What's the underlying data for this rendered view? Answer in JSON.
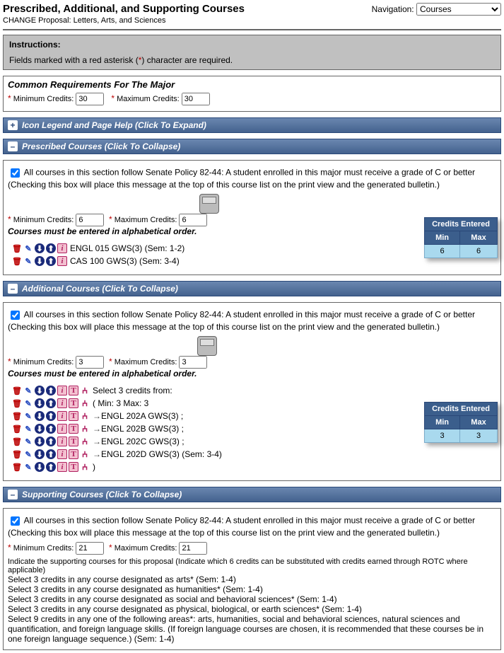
{
  "header": {
    "title": "Prescribed, Additional, and Supporting Courses",
    "subtitle": "CHANGE Proposal: Letters, Arts, and Sciences",
    "nav_label": "Navigation:",
    "nav_selected": "Courses"
  },
  "instructions": {
    "heading": "Instructions:",
    "text_before": "Fields marked with a red asterisk (",
    "asterisk": "*",
    "text_after": ") character are required."
  },
  "common": {
    "title": "Common Requirements For The Major",
    "min_label": " Minimum Credits: ",
    "min_value": "30",
    "max_label": " Maximum Credits: ",
    "max_value": "30"
  },
  "legend_bar": {
    "toggle": "+",
    "label": "Icon Legend and Page Help (Click To Expand)"
  },
  "prescribed": {
    "bar_toggle": "–",
    "bar_label": "Prescribed Courses (Click To Collapse)",
    "policy_checked": true,
    "policy_text": "All courses in this section follow Senate Policy 82-44: A student enrolled in this major must receive a grade of C or better",
    "policy_sub": "(Checking this box will place this message at the top of this course list on the print view and the generated bulletin.)",
    "min_label": " Minimum Credits: ",
    "min_value": "6",
    "max_label": " Maximum Credits: ",
    "max_value": "6",
    "alpha_note": "Courses must be entered in alphabetical order.",
    "credits": {
      "header": "Credits Entered",
      "min_h": "Min",
      "max_h": "Max",
      "min_v": "6",
      "max_v": "6"
    },
    "rows": [
      {
        "text": "ENGL 015 GWS(3) (Sem: 1-2)"
      },
      {
        "text": "CAS 100 GWS(3) (Sem: 3-4)"
      }
    ]
  },
  "additional": {
    "bar_toggle": "–",
    "bar_label": "Additional Courses (Click To Collapse)",
    "policy_checked": true,
    "policy_text": "All courses in this section follow Senate Policy 82-44: A student enrolled in this major must receive a grade of C or better",
    "policy_sub": "(Checking this box will place this message at the top of this course list on the print view and the generated bulletin.)",
    "min_label": " Minimum Credits: ",
    "min_value": "3",
    "max_label": " Maximum Credits: ",
    "max_value": "3",
    "alpha_note": "Courses must be entered in alphabetical order.",
    "credits": {
      "header": "Credits Entered",
      "min_h": "Min",
      "max_h": "Max",
      "min_v": "3",
      "max_v": "3"
    },
    "rows": [
      {
        "text": "Select 3 credits from:",
        "arrow": false
      },
      {
        "text": "( Min: 3 Max: 3",
        "arrow": false
      },
      {
        "text": "ENGL 202A GWS(3) ;",
        "arrow": true
      },
      {
        "text": "ENGL 202B GWS(3) ;",
        "arrow": true
      },
      {
        "text": "ENGL 202C GWS(3) ;",
        "arrow": true
      },
      {
        "text": "ENGL 202D GWS(3) (Sem: 3-4)",
        "arrow": true
      },
      {
        "text": ")",
        "arrow": false
      }
    ]
  },
  "supporting": {
    "bar_toggle": "–",
    "bar_label": "Supporting Courses (Click To Collapse)",
    "policy_checked": true,
    "policy_text": "All courses in this section follow Senate Policy 82-44: A student enrolled in this major must receive a grade of C or better",
    "policy_sub": "(Checking this box will place this message at the top of this course list on the print view and the generated bulletin.)",
    "min_label": " Minimum Credits: ",
    "min_value": "21",
    "max_label": " Maximum Credits: ",
    "max_value": "21",
    "desc_bold": "Indicate the supporting courses for this proposal ",
    "desc_rest": "(Indicate which 6 credits can be substituted with credits earned through ROTC where applicable)",
    "lines": [
      "Select 3 credits in any course designated as arts* (Sem: 1-4)",
      "Select 3 credits in any course designated as humanities* (Sem: 1-4)",
      "Select 3 credits in any course designated as social and behavioral sciences* (Sem: 1-4)",
      "Select 3 credits in any course designated as physical, biological, or earth sciences* (Sem: 1-4)",
      "Select 9 credits in any one of the following areas*: arts, humanities, social and behavioral sciences, natural sciences and quantification, and foreign language skills. (If foreign language courses are chosen, it is recommended that these courses be in one foreign language sequence.) (Sem: 1-4)"
    ]
  }
}
